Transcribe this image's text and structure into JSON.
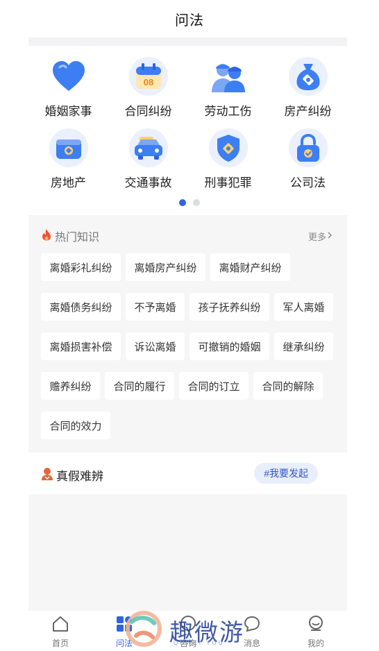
{
  "header": {
    "title": "问法"
  },
  "categories": [
    {
      "label": "婚姻家事",
      "icon": "heart-icon"
    },
    {
      "label": "合同纠纷",
      "icon": "calendar-icon",
      "badge": "08"
    },
    {
      "label": "劳动工伤",
      "icon": "workers-icon"
    },
    {
      "label": "房产纠纷",
      "icon": "money-bag-icon"
    },
    {
      "label": "房地产",
      "icon": "wallet-icon"
    },
    {
      "label": "交通事故",
      "icon": "car-icon"
    },
    {
      "label": "刑事犯罪",
      "icon": "shield-icon"
    },
    {
      "label": "公司法",
      "icon": "lock-icon"
    }
  ],
  "pager": {
    "pages": 2,
    "active": 1
  },
  "hot": {
    "title": "热门知识",
    "more": "更多",
    "tags": [
      "离婚彩礼纠纷",
      "离婚房产纠纷",
      "离婚财产纠纷",
      "离婚债务纠纷",
      "不予离婚",
      "孩子抚养纠纷",
      "军人离婚",
      "离婚损害补偿",
      "诉讼离婚",
      "可撤销的婚姻",
      "继承纠纷",
      "赡养纠纷",
      "合同的履行",
      "合同的订立",
      "合同的解除",
      "合同的效力"
    ]
  },
  "zhenjia": {
    "title": "真假难辨",
    "button": "#我要发起"
  },
  "tabs": [
    {
      "label": "首页",
      "icon": "home-icon"
    },
    {
      "label": "问法",
      "icon": "grid-icon",
      "active": true
    },
    {
      "label": "咨询",
      "icon": "chat-icon"
    },
    {
      "label": "消息",
      "icon": "message-icon"
    },
    {
      "label": "我的",
      "icon": "profile-icon"
    }
  ],
  "watermark": {
    "text": "趣微游",
    "sub": "QUWEI YOU"
  },
  "colors": {
    "accent": "#2f63e0",
    "tagBg": "#ffffff",
    "panelBg": "#f6f6f7",
    "fire": "#f0552f"
  }
}
